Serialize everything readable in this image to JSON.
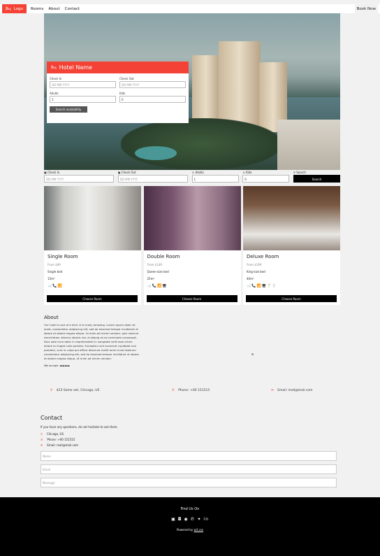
{
  "nav": {
    "logo_label": "Logo",
    "links": [
      "Rooms",
      "About",
      "Contact"
    ],
    "book_now": "Book Now"
  },
  "hotel_card": {
    "title": "Hotel Name",
    "check_in_label": "Check In",
    "check_out_label": "Check Out",
    "adults_label": "Adults",
    "kids_label": "Kids",
    "date_placeholder": "DD MM YYYY",
    "adults_value": "1",
    "kids_value": "0",
    "button": "Search availability"
  },
  "search_bar": {
    "check_in_label": "Check In",
    "check_out_label": "Check Out",
    "adults_label": "Adults",
    "kids_label": "Kids",
    "search_label": "Search",
    "date_placeholder": "DD MM YYYY",
    "adults_value": "1",
    "kids_value": "0",
    "button": "Search"
  },
  "rooms": [
    {
      "name": "Single Room",
      "price": "From $99",
      "bed": "Single bed",
      "size": "15m²",
      "icons": "🛁📞📶",
      "button": "Choose Room"
    },
    {
      "name": "Double Room",
      "price": "From $149",
      "bed": "Queen-size bed",
      "size": "25m²",
      "icons": "🛁📞📶🖥",
      "button": "Choose Room"
    },
    {
      "name": "Deluxe Room",
      "price": "From $199",
      "bed": "King-size bed",
      "size": "40m²",
      "icons": "🛁📞📶🖥🍸🍴",
      "button": "Choose Room"
    }
  ],
  "about": {
    "title": "About",
    "text": "Our hotel is one of a kind. It is truely amazing. Lorem ipsum dolor sit amet, consectetur adipiscing elit, sed do eiusmod tempor incididunt ut labore et dolore magna aliqua. Ut enim ad minim veniam, quis nostrud exercitation ullamco laboris nisi ut aliquip ex ea commodo consequat. Duis aute irure dolor in reprehenderit in voluptate velit esse cillum dolore eu fugiat nulla pariatur. Excepteur sint occaecat cupidatat non proident, sunt in culpa qui officia deserunt mollit anim id est laborum consectetur adipiscing elit, sed do eiusmod tempor incididunt ut labore et dolore magna aliqua. Ut enim ad minim veniam.",
    "accept": "We accept:"
  },
  "info": {
    "address": "423 Some adr, Chicago, US",
    "phone": "Phone: +00 151515",
    "email": "Email: mail@mail.com"
  },
  "contact": {
    "title": "Contact",
    "lead": "If you have any questions, do not hesitate to ask them.",
    "city": "Chicago, US",
    "phone": "Phone: +00 151515",
    "email": "Email: mail@mail.com",
    "name_placeholder": "Name",
    "email_placeholder": "Email",
    "message_placeholder": "Message"
  },
  "footer": {
    "find_us": "Find Us On",
    "powered_prefix": "Powered by",
    "powered_link": "w3.css"
  }
}
